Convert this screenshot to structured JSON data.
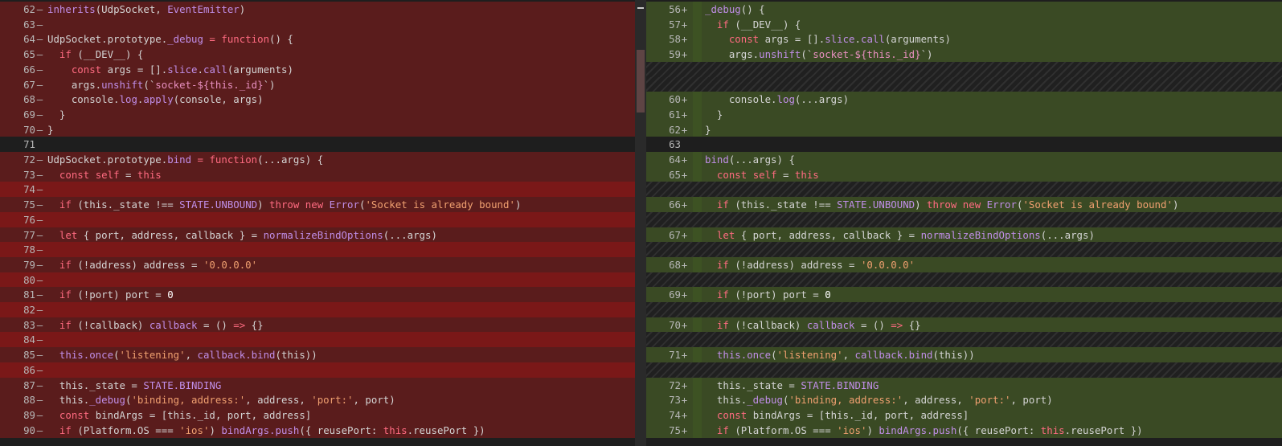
{
  "editor": {
    "type": "side-by-side diff",
    "colors": {
      "left_removed_line": "#5a1c1c",
      "left_removed_block": "#7a1818",
      "right_added_line": "#3a4a24",
      "right_added_block": "#344524",
      "common": "#1e1e1e",
      "hatch": "#202020"
    },
    "icons": {
      "added_marker": "plus-icon",
      "removed_marker": "minus-icon"
    }
  },
  "left": {
    "lines": [
      {
        "n": "62",
        "m": "—",
        "k": "mod",
        "t": [
          [
            "inherits",
            "tok-fn"
          ],
          [
            "(UdpSocket, ",
            "tok-name"
          ],
          [
            "EventEmitter",
            "tok-fn"
          ],
          [
            ")",
            "tok-name"
          ]
        ]
      },
      {
        "n": "63",
        "m": "—",
        "k": "mod",
        "t": []
      },
      {
        "n": "64",
        "m": "—",
        "k": "mod",
        "t": [
          [
            "UdpSocket.prototype.",
            "tok-name"
          ],
          [
            "_debug",
            "tok-fn"
          ],
          [
            " = ",
            "tok-kw"
          ],
          [
            "function",
            "tok-kw"
          ],
          [
            "() {",
            "tok-name"
          ]
        ]
      },
      {
        "n": "65",
        "m": "—",
        "k": "mod",
        "t": [
          [
            "  if ",
            "tok-kw"
          ],
          [
            "(__DEV__) {",
            "tok-name"
          ]
        ]
      },
      {
        "n": "66",
        "m": "—",
        "k": "mod",
        "t": [
          [
            "    const ",
            "tok-kw"
          ],
          [
            "args",
            "tok-name"
          ],
          [
            " = [].",
            "tok-name"
          ],
          [
            "slice",
            "tok-prop"
          ],
          [
            ".",
            "tok-name"
          ],
          [
            "call",
            "tok-prop"
          ],
          [
            "(arguments)",
            "tok-name"
          ]
        ]
      },
      {
        "n": "67",
        "m": "—",
        "k": "mod",
        "t": [
          [
            "    args.",
            "tok-name"
          ],
          [
            "unshift",
            "tok-fn"
          ],
          [
            "(`",
            "tok-name"
          ],
          [
            "socket-${this._id}",
            "tok-tpl"
          ],
          [
            "`)",
            "tok-name"
          ]
        ]
      },
      {
        "n": "68",
        "m": "—",
        "k": "mod",
        "t": [
          [
            "    console.",
            "tok-name"
          ],
          [
            "log",
            "tok-fn"
          ],
          [
            ".",
            "tok-name"
          ],
          [
            "apply",
            "tok-fn"
          ],
          [
            "(console, args)",
            "tok-name"
          ]
        ]
      },
      {
        "n": "69",
        "m": "—",
        "k": "mod",
        "t": [
          [
            "  }",
            "tok-name"
          ]
        ]
      },
      {
        "n": "70",
        "m": "—",
        "k": "mod",
        "t": [
          [
            "}",
            "tok-name"
          ]
        ]
      },
      {
        "n": "71",
        "m": "",
        "k": "same",
        "t": []
      },
      {
        "n": "72",
        "m": "—",
        "k": "mod",
        "t": [
          [
            "UdpSocket.prototype.",
            "tok-name"
          ],
          [
            "bind",
            "tok-fn"
          ],
          [
            " = ",
            "tok-kw"
          ],
          [
            "function",
            "tok-kw"
          ],
          [
            "(...args) {",
            "tok-name"
          ]
        ]
      },
      {
        "n": "73",
        "m": "—",
        "k": "mod",
        "t": [
          [
            "  const ",
            "tok-kw"
          ],
          [
            "self",
            "tok-kw"
          ],
          [
            " = ",
            "tok-name"
          ],
          [
            "this",
            "tok-kw"
          ]
        ]
      },
      {
        "n": "74",
        "m": "—",
        "k": "del",
        "t": []
      },
      {
        "n": "75",
        "m": "—",
        "k": "mod",
        "t": [
          [
            "  if ",
            "tok-kw"
          ],
          [
            "(this._state !== ",
            "tok-name"
          ],
          [
            "STATE.UNBOUND",
            "tok-fn"
          ],
          [
            ") ",
            "tok-name"
          ],
          [
            "throw new ",
            "tok-kw"
          ],
          [
            "Error",
            "tok-fn"
          ],
          [
            "(",
            "tok-name"
          ],
          [
            "'Socket is already bound'",
            "tok-str"
          ],
          [
            ")",
            "tok-name"
          ]
        ]
      },
      {
        "n": "76",
        "m": "—",
        "k": "del",
        "t": []
      },
      {
        "n": "77",
        "m": "—",
        "k": "mod",
        "t": [
          [
            "  let ",
            "tok-kw"
          ],
          [
            "{ port, address, callback } = ",
            "tok-name"
          ],
          [
            "normalizeBindOptions",
            "tok-fn"
          ],
          [
            "(...args)",
            "tok-name"
          ]
        ]
      },
      {
        "n": "78",
        "m": "—",
        "k": "del",
        "t": []
      },
      {
        "n": "79",
        "m": "—",
        "k": "mod",
        "t": [
          [
            "  if ",
            "tok-kw"
          ],
          [
            "(!address) address = ",
            "tok-name"
          ],
          [
            "'0.0.0.0'",
            "tok-str"
          ]
        ]
      },
      {
        "n": "80",
        "m": "—",
        "k": "del",
        "t": []
      },
      {
        "n": "81",
        "m": "—",
        "k": "mod",
        "t": [
          [
            "  if ",
            "tok-kw"
          ],
          [
            "(!port) port = ",
            "tok-name"
          ],
          [
            "0",
            "tok-num"
          ]
        ]
      },
      {
        "n": "82",
        "m": "—",
        "k": "del",
        "t": []
      },
      {
        "n": "83",
        "m": "—",
        "k": "mod",
        "t": [
          [
            "  if ",
            "tok-kw"
          ],
          [
            "(!callback) ",
            "tok-name"
          ],
          [
            "callback",
            "tok-fn"
          ],
          [
            " = () ",
            "tok-name"
          ],
          [
            "=>",
            "tok-kw"
          ],
          [
            " {}",
            "tok-name"
          ]
        ]
      },
      {
        "n": "84",
        "m": "—",
        "k": "del",
        "t": []
      },
      {
        "n": "85",
        "m": "—",
        "k": "mod",
        "t": [
          [
            "  this.",
            "tok-fn"
          ],
          [
            "once",
            "tok-fn"
          ],
          [
            "(",
            "tok-name"
          ],
          [
            "'listening'",
            "tok-str"
          ],
          [
            ", ",
            "tok-name"
          ],
          [
            "callback.",
            "tok-fn"
          ],
          [
            "bind",
            "tok-fn"
          ],
          [
            "(this))",
            "tok-name"
          ]
        ]
      },
      {
        "n": "86",
        "m": "—",
        "k": "del",
        "t": []
      },
      {
        "n": "87",
        "m": "—",
        "k": "mod",
        "t": [
          [
            "  this._state = ",
            "tok-name"
          ],
          [
            "STATE.BINDING",
            "tok-fn"
          ]
        ]
      },
      {
        "n": "88",
        "m": "—",
        "k": "mod",
        "t": [
          [
            "  this.",
            "tok-name"
          ],
          [
            "_debug",
            "tok-fn"
          ],
          [
            "(",
            "tok-name"
          ],
          [
            "'binding, address:'",
            "tok-str"
          ],
          [
            ", address, ",
            "tok-name"
          ],
          [
            "'port:'",
            "tok-str"
          ],
          [
            ", port)",
            "tok-name"
          ]
        ]
      },
      {
        "n": "89",
        "m": "—",
        "k": "mod",
        "t": [
          [
            "  const ",
            "tok-kw"
          ],
          [
            "bindArgs = [this._id, port, address]",
            "tok-name"
          ]
        ]
      },
      {
        "n": "90",
        "m": "—",
        "k": "mod",
        "t": [
          [
            "  if ",
            "tok-kw"
          ],
          [
            "(Platform.OS === ",
            "tok-name"
          ],
          [
            "'ios'",
            "tok-str"
          ],
          [
            ") ",
            "tok-name"
          ],
          [
            "bindArgs.",
            "tok-fn"
          ],
          [
            "push",
            "tok-fn"
          ],
          [
            "({ reusePort: ",
            "tok-name"
          ],
          [
            "this",
            "tok-kw"
          ],
          [
            ".reusePort })",
            "tok-name"
          ]
        ]
      }
    ]
  },
  "right": {
    "lines": [
      {
        "n": "56",
        "m": "+",
        "k": "mod",
        "t": [
          [
            "_debug",
            "tok-fn"
          ],
          [
            "() {",
            "tok-name"
          ]
        ]
      },
      {
        "n": "57",
        "m": "+",
        "k": "mod",
        "t": [
          [
            "  if ",
            "tok-kw"
          ],
          [
            "(__DEV__) {",
            "tok-name"
          ]
        ]
      },
      {
        "n": "58",
        "m": "+",
        "k": "mod",
        "t": [
          [
            "    const ",
            "tok-kw"
          ],
          [
            "args",
            "tok-name"
          ],
          [
            " = [].",
            "tok-name"
          ],
          [
            "slice",
            "tok-prop"
          ],
          [
            ".",
            "tok-name"
          ],
          [
            "call",
            "tok-prop"
          ],
          [
            "(arguments)",
            "tok-name"
          ]
        ]
      },
      {
        "n": "59",
        "m": "+",
        "k": "mod",
        "t": [
          [
            "    args.",
            "tok-name"
          ],
          [
            "unshift",
            "tok-fn"
          ],
          [
            "(`",
            "tok-name"
          ],
          [
            "socket-${this._id}",
            "tok-tpl"
          ],
          [
            "`)",
            "tok-name"
          ]
        ]
      },
      {
        "n": "",
        "m": "",
        "k": "hatch",
        "t": []
      },
      {
        "n": "",
        "m": "",
        "k": "hatch",
        "t": []
      },
      {
        "n": "60",
        "m": "+",
        "k": "mod",
        "t": [
          [
            "    console.",
            "tok-name"
          ],
          [
            "log",
            "tok-fn"
          ],
          [
            "(...args)",
            "tok-name"
          ]
        ]
      },
      {
        "n": "61",
        "m": "+",
        "k": "mod",
        "t": [
          [
            "  }",
            "tok-name"
          ]
        ]
      },
      {
        "n": "62",
        "m": "+",
        "k": "mod",
        "t": [
          [
            "}",
            "tok-name"
          ]
        ]
      },
      {
        "n": "63",
        "m": "",
        "k": "same",
        "t": []
      },
      {
        "n": "64",
        "m": "+",
        "k": "mod",
        "t": [
          [
            "bind",
            "tok-fn"
          ],
          [
            "(...args) {",
            "tok-name"
          ]
        ]
      },
      {
        "n": "65",
        "m": "+",
        "k": "mod",
        "t": [
          [
            "  const ",
            "tok-kw"
          ],
          [
            "self",
            "tok-kw"
          ],
          [
            " = ",
            "tok-name"
          ],
          [
            "this",
            "tok-kw"
          ]
        ]
      },
      {
        "n": "",
        "m": "",
        "k": "hatch",
        "t": []
      },
      {
        "n": "66",
        "m": "+",
        "k": "mod",
        "t": [
          [
            "  if ",
            "tok-kw"
          ],
          [
            "(this._state !== ",
            "tok-name"
          ],
          [
            "STATE.UNBOUND",
            "tok-fn"
          ],
          [
            ") ",
            "tok-name"
          ],
          [
            "throw new ",
            "tok-kw"
          ],
          [
            "Error",
            "tok-fn"
          ],
          [
            "(",
            "tok-name"
          ],
          [
            "'Socket is already bound'",
            "tok-str"
          ],
          [
            ")",
            "tok-name"
          ]
        ]
      },
      {
        "n": "",
        "m": "",
        "k": "hatch",
        "t": []
      },
      {
        "n": "67",
        "m": "+",
        "k": "mod",
        "t": [
          [
            "  let ",
            "tok-kw"
          ],
          [
            "{ port, address, callback } = ",
            "tok-name"
          ],
          [
            "normalizeBindOptions",
            "tok-fn"
          ],
          [
            "(...args)",
            "tok-name"
          ]
        ]
      },
      {
        "n": "",
        "m": "",
        "k": "hatch",
        "t": []
      },
      {
        "n": "68",
        "m": "+",
        "k": "mod",
        "t": [
          [
            "  if ",
            "tok-kw"
          ],
          [
            "(!address) address = ",
            "tok-name"
          ],
          [
            "'0.0.0.0'",
            "tok-str"
          ]
        ]
      },
      {
        "n": "",
        "m": "",
        "k": "hatch",
        "t": []
      },
      {
        "n": "69",
        "m": "+",
        "k": "mod",
        "t": [
          [
            "  if ",
            "tok-kw"
          ],
          [
            "(!port) port = ",
            "tok-name"
          ],
          [
            "0",
            "tok-num"
          ]
        ]
      },
      {
        "n": "",
        "m": "",
        "k": "hatch",
        "t": []
      },
      {
        "n": "70",
        "m": "+",
        "k": "mod",
        "t": [
          [
            "  if ",
            "tok-kw"
          ],
          [
            "(!callback) ",
            "tok-name"
          ],
          [
            "callback",
            "tok-fn"
          ],
          [
            " = () ",
            "tok-name"
          ],
          [
            "=>",
            "tok-kw"
          ],
          [
            " {}",
            "tok-name"
          ]
        ]
      },
      {
        "n": "",
        "m": "",
        "k": "hatch",
        "t": []
      },
      {
        "n": "71",
        "m": "+",
        "k": "mod",
        "t": [
          [
            "  this.",
            "tok-fn"
          ],
          [
            "once",
            "tok-fn"
          ],
          [
            "(",
            "tok-name"
          ],
          [
            "'listening'",
            "tok-str"
          ],
          [
            ", ",
            "tok-name"
          ],
          [
            "callback.",
            "tok-fn"
          ],
          [
            "bind",
            "tok-fn"
          ],
          [
            "(this))",
            "tok-name"
          ]
        ]
      },
      {
        "n": "",
        "m": "",
        "k": "hatch",
        "t": []
      },
      {
        "n": "72",
        "m": "+",
        "k": "mod",
        "t": [
          [
            "  this._state = ",
            "tok-name"
          ],
          [
            "STATE.BINDING",
            "tok-fn"
          ]
        ]
      },
      {
        "n": "73",
        "m": "+",
        "k": "mod",
        "t": [
          [
            "  this.",
            "tok-name"
          ],
          [
            "_debug",
            "tok-fn"
          ],
          [
            "(",
            "tok-name"
          ],
          [
            "'binding, address:'",
            "tok-str"
          ],
          [
            ", address, ",
            "tok-name"
          ],
          [
            "'port:'",
            "tok-str"
          ],
          [
            ", port)",
            "tok-name"
          ]
        ]
      },
      {
        "n": "74",
        "m": "+",
        "k": "mod",
        "t": [
          [
            "  const ",
            "tok-kw"
          ],
          [
            "bindArgs = [this._id, port, address]",
            "tok-name"
          ]
        ]
      },
      {
        "n": "75",
        "m": "+",
        "k": "mod",
        "t": [
          [
            "  if ",
            "tok-kw"
          ],
          [
            "(Platform.OS === ",
            "tok-name"
          ],
          [
            "'ios'",
            "tok-str"
          ],
          [
            ") ",
            "tok-name"
          ],
          [
            "bindArgs.",
            "tok-fn"
          ],
          [
            "push",
            "tok-fn"
          ],
          [
            "({ reusePort: ",
            "tok-name"
          ],
          [
            "this",
            "tok-kw"
          ],
          [
            ".reusePort })",
            "tok-name"
          ]
        ]
      }
    ]
  }
}
